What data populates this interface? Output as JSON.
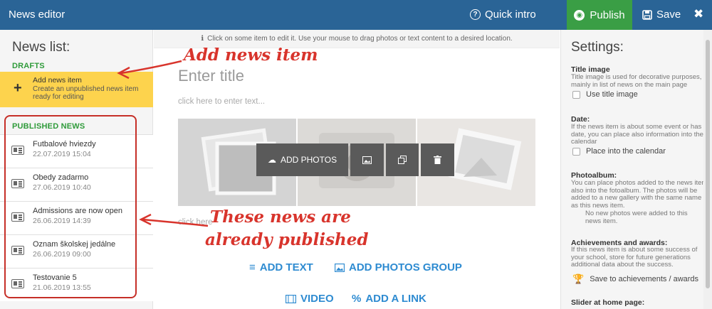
{
  "topbar": {
    "title": "News editor",
    "quick_intro": "Quick intro",
    "publish": "Publish",
    "save": "Save",
    "close": "✖"
  },
  "left": {
    "heading": "News list:",
    "drafts_label": "DRAFTS",
    "add_item": {
      "title": "Add news item",
      "desc": "Create an unpublished news item ready for editing"
    },
    "published_label": "PUBLISHED NEWS",
    "items": [
      {
        "title": "Futbalové hviezdy",
        "date": "22.07.2019 15:04"
      },
      {
        "title": "Obedy zadarmo",
        "date": "27.06.2019 10:40"
      },
      {
        "title": "Admissions are now open",
        "date": "26.06.2019 14:39"
      },
      {
        "title": "Oznam školskej jedálne",
        "date": "26.06.2019 09:00"
      },
      {
        "title": "Testovanie 5",
        "date": "21.06.2019 13:55"
      }
    ]
  },
  "center": {
    "hint": "Click on some item to edit it. Use your mouse to drag photos or text content to a desired location.",
    "enter_title": "Enter title",
    "enter_text": "click here to enter text...",
    "add_photos": "ADD PHOTOS",
    "click_here": "click here",
    "add_text": "ADD TEXT",
    "add_photos_group": "ADD PHOTOS GROUP",
    "video": "VIDEO",
    "add_link": "ADD A LINK"
  },
  "settings": {
    "heading": "Settings:",
    "title_image": {
      "title": "Title image",
      "desc": "Title image is used for decorative purposes, mainly in list of news on the main page",
      "checkbox": "Use title image"
    },
    "date": {
      "title": "Date:",
      "desc": "If the news item is about some event or has date, you can place also information into the calendar",
      "checkbox": "Place into the calendar"
    },
    "photoalbum": {
      "title": "Photoalbum:",
      "desc": "You can place photos added to the news item also into the fotoalbum. The photos will be added to a new gallery with the same name as this news item.",
      "note": "No new photos were added to this news item."
    },
    "achievements": {
      "title": "Achievements and awards:",
      "desc": "If this news item is about some success of your school, store for future generations additional data about the success.",
      "action": "Save to achievements / awards"
    },
    "slider": {
      "title": "Slider at home page:"
    }
  },
  "annotations": {
    "add_news_item": "Add news item",
    "published_line1": "These news are",
    "published_line2": "already published"
  },
  "colors": {
    "topbar": "#2a6496",
    "publish": "#3a9e45",
    "draft_highlight": "#fdd34d",
    "section_label": "#2f9b3a",
    "link_blue": "#2e8bd1",
    "annotation_red": "#d8342c"
  }
}
